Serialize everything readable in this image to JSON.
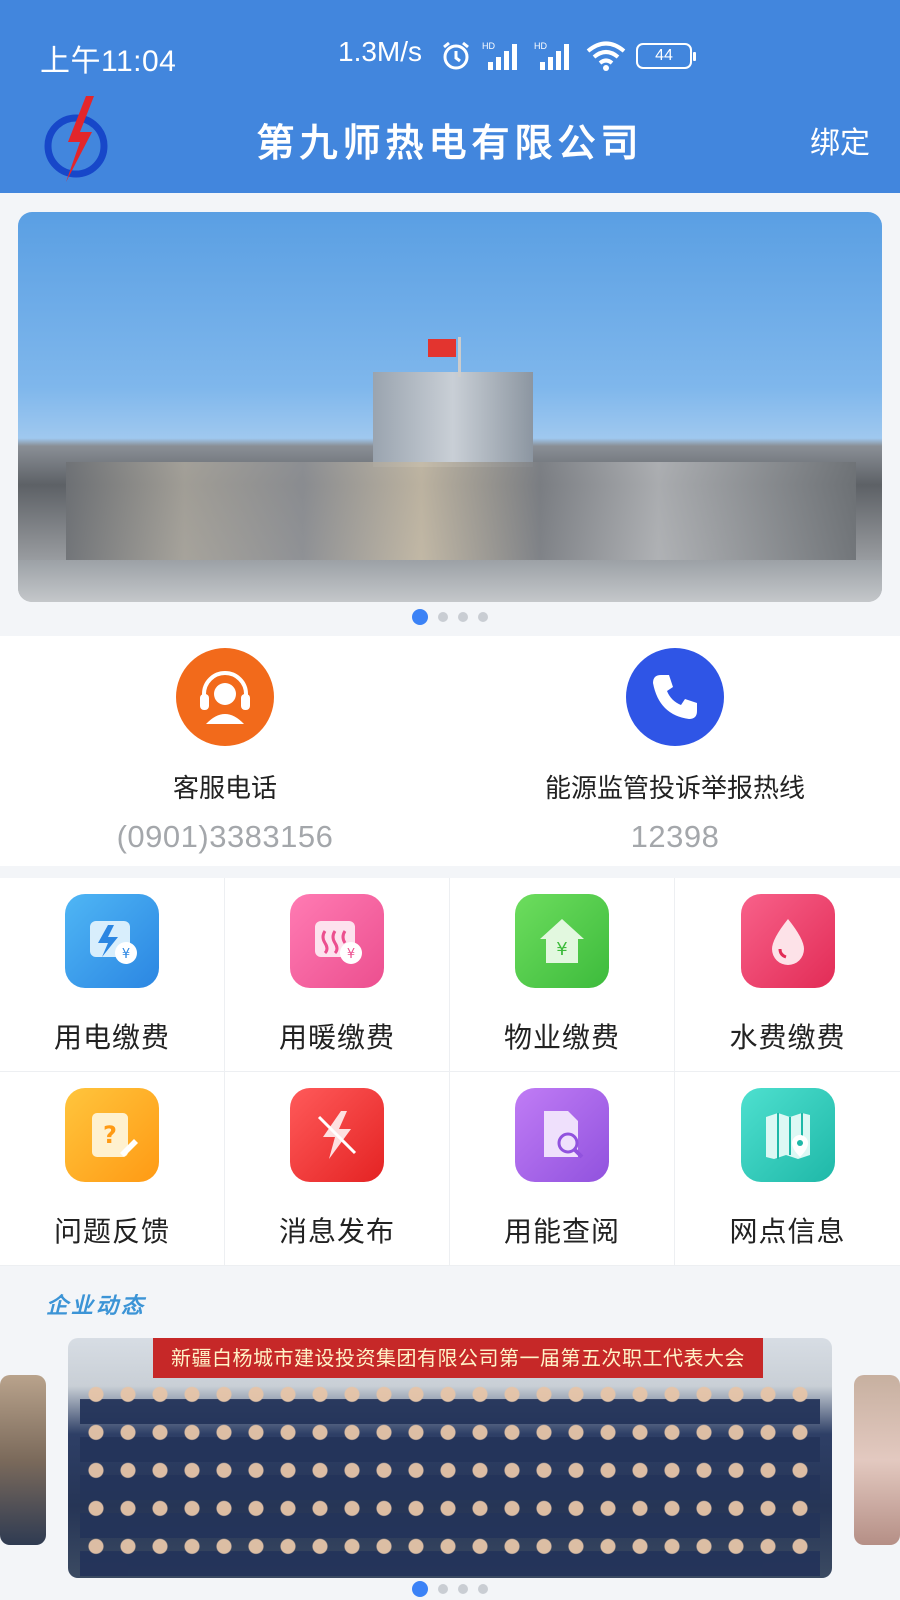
{
  "status_bar": {
    "time": "上午11:04",
    "network_speed": "1.3M/s",
    "battery": "44"
  },
  "header": {
    "title": "第九师热电有限公司",
    "bind_label": "绑定",
    "background_color": "#4286dd"
  },
  "banner": {
    "slide_count": 4,
    "active_index": 0
  },
  "contacts": [
    {
      "label": "客服电话",
      "phone": "(0901)3383156",
      "icon": "headset-icon",
      "color": "#f26a1b"
    },
    {
      "label": "能源监管投诉举报热线",
      "phone": "12398",
      "icon": "phone-icon",
      "color": "#2f55e6"
    }
  ],
  "services": [
    {
      "label": "用电缴费",
      "icon": "electricity-payment-icon",
      "color": "#2f9ee8"
    },
    {
      "label": "用暖缴费",
      "icon": "heating-payment-icon",
      "color": "#f2579a"
    },
    {
      "label": "物业缴费",
      "icon": "property-payment-icon",
      "color": "#4cc94a"
    },
    {
      "label": "水费缴费",
      "icon": "water-payment-icon",
      "color": "#ef3f64"
    },
    {
      "label": "问题反馈",
      "icon": "feedback-icon",
      "color": "#ffae1f"
    },
    {
      "label": "消息发布",
      "icon": "message-publish-icon",
      "color": "#ee3b3b"
    },
    {
      "label": "用能查阅",
      "icon": "energy-query-icon",
      "color": "#a766e6"
    },
    {
      "label": "网点信息",
      "icon": "outlet-map-icon",
      "color": "#2fc9b9"
    }
  ],
  "news": {
    "section_title": "企业动态",
    "card_caption": "新疆白杨城市建设投资集团有限公司第一届第五次职工代表大会",
    "slide_count": 4,
    "active_index": 0
  }
}
